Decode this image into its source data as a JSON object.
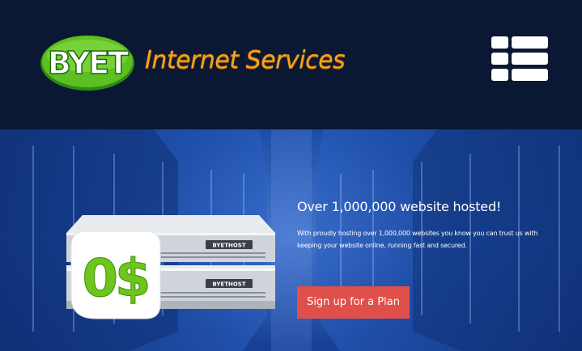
{
  "header": {
    "logo": {
      "brand_text": "BYET",
      "tagline": "Internet Services"
    },
    "menu_button": {
      "icon": "hamburger-list-icon"
    }
  },
  "hero": {
    "server_art": {
      "price_badge": "0$",
      "unit_label_top": "BYETHOST",
      "unit_label_bottom": "BYETHOST"
    },
    "title": "Over 1,000,000 website hosted!",
    "description": "With proudly hosting over 1,000,000 websites you know you can trust us with keeping your website online, running fast and secured.",
    "cta_label": "Sign up for a Plan"
  },
  "colors": {
    "header_bg": "#0a1833",
    "hero_blue": "#1d4fae",
    "logo_green": "#6fcf2c",
    "logo_orange": "#f7a21c",
    "cta_red": "#e0504a",
    "badge_green": "#6cc61b"
  }
}
